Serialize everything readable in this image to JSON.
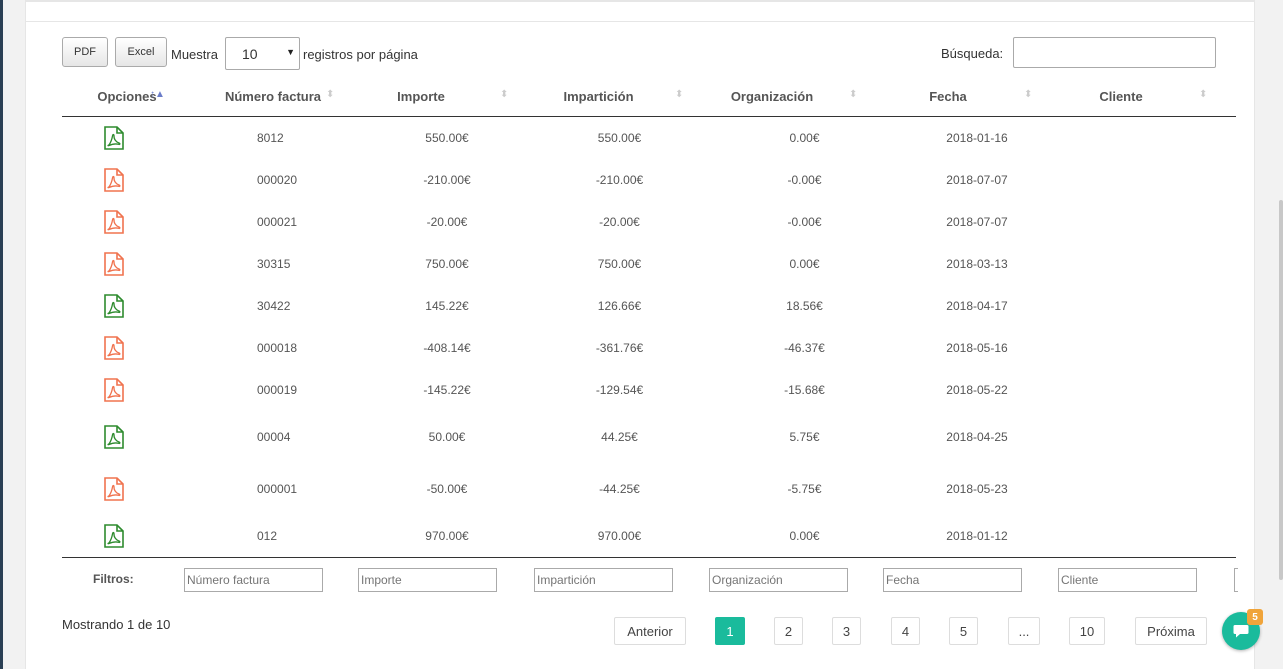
{
  "toolbar": {
    "pdf_label": "PDF",
    "excel_label": "Excel",
    "show_label": "Muestra",
    "per_page_value": "10",
    "per_page_suffix": "registros por página",
    "search_label": "Búsqueda:",
    "search_value": ""
  },
  "table": {
    "columns": [
      "Opciones",
      "Número factura",
      "Importe",
      "Impartición",
      "Organización",
      "Fecha",
      "Cliente"
    ],
    "rows": [
      {
        "status": "paid",
        "numero": "8012",
        "importe": "550.00€",
        "imparticion": "550.00€",
        "organizacion": "0.00€",
        "fecha": "2018-01-16",
        "cliente": ""
      },
      {
        "status": "unpaid",
        "numero": "000020",
        "importe": "-210.00€",
        "imparticion": "-210.00€",
        "organizacion": "-0.00€",
        "fecha": "2018-07-07",
        "cliente": ""
      },
      {
        "status": "unpaid",
        "numero": "000021",
        "importe": "-20.00€",
        "imparticion": "-20.00€",
        "organizacion": "-0.00€",
        "fecha": "2018-07-07",
        "cliente": ""
      },
      {
        "status": "unpaid",
        "numero": "30315",
        "importe": "750.00€",
        "imparticion": "750.00€",
        "organizacion": "0.00€",
        "fecha": "2018-03-13",
        "cliente": ""
      },
      {
        "status": "paid",
        "numero": "30422",
        "importe": "145.22€",
        "imparticion": "126.66€",
        "organizacion": "18.56€",
        "fecha": "2018-04-17",
        "cliente": ""
      },
      {
        "status": "unpaid",
        "numero": "000018",
        "importe": "-408.14€",
        "imparticion": "-361.76€",
        "organizacion": "-46.37€",
        "fecha": "2018-05-16",
        "cliente": ""
      },
      {
        "status": "unpaid",
        "numero": "000019",
        "importe": "-145.22€",
        "imparticion": "-129.54€",
        "organizacion": "-15.68€",
        "fecha": "2018-05-22",
        "cliente": ""
      },
      {
        "status": "paid",
        "numero": "00004",
        "importe": "50.00€",
        "imparticion": "44.25€",
        "organizacion": "5.75€",
        "fecha": "2018-04-25",
        "cliente": ""
      },
      {
        "status": "unpaid",
        "numero": "000001",
        "importe": "-50.00€",
        "imparticion": "-44.25€",
        "organizacion": "-5.75€",
        "fecha": "2018-05-23",
        "cliente": ""
      },
      {
        "status": "paid",
        "numero": "012",
        "importe": "970.00€",
        "imparticion": "970.00€",
        "organizacion": "0.00€",
        "fecha": "2018-01-12",
        "cliente": ""
      }
    ]
  },
  "filters": {
    "label": "Filtros:",
    "placeholders": [
      "Número factura",
      "Importe",
      "Impartición",
      "Organización",
      "Fecha",
      "Cliente"
    ]
  },
  "footer": {
    "info": "Mostrando 1 de 10",
    "prev_label": "Anterior",
    "next_label": "Próxima",
    "pages": [
      "1",
      "2",
      "3",
      "4",
      "5",
      "...",
      "10"
    ],
    "active_page": "1"
  },
  "chat": {
    "badge": "5"
  },
  "colors": {
    "accent": "#1abb9c",
    "pdf_paid": "#2e8b2e",
    "pdf_unpaid": "#f0734f",
    "badge": "#f0a43a"
  },
  "icons": {
    "row_icon": "pdf-file-icon",
    "chat_icon": "chat-bubble-icon",
    "sort_icon": "sort-arrows-icon"
  }
}
